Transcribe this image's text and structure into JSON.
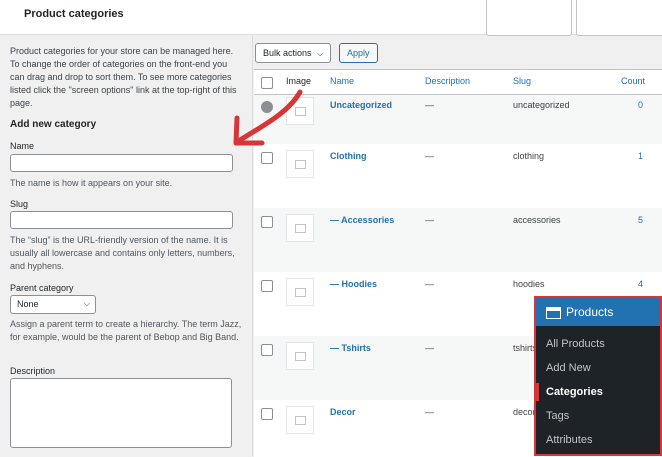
{
  "page": {
    "title": "Product categories"
  },
  "left": {
    "intro": "Product categories for your store can be managed here. To change the order of categories on the front-end you can drag and drop to sort them. To see more categories listed click the \"screen options\" link at the top-right of this page.",
    "add_heading": "Add new category",
    "name_label": "Name",
    "name_help": "The name is how it appears on your site.",
    "slug_label": "Slug",
    "slug_help": "The “slug” is the URL-friendly version of the name. It is usually all lowercase and contains only letters, numbers, and hyphens.",
    "parent_label": "Parent category",
    "parent_value": "None",
    "parent_help": "Assign a parent term to create a hierarchy. The term Jazz, for example, would be the parent of Bebop and Big Band.",
    "description_label": "Description"
  },
  "toolbar": {
    "bulk_label": "Bulk actions",
    "apply_label": "Apply"
  },
  "table": {
    "headers": {
      "image": "Image",
      "name": "Name",
      "description": "Description",
      "slug": "Slug",
      "count": "Count"
    },
    "rows": [
      {
        "name": "Uncategorized",
        "description": "—",
        "slug": "uncategorized",
        "count": "0"
      },
      {
        "name": "Clothing",
        "description": "—",
        "slug": "clothing",
        "count": "1"
      },
      {
        "name": "— Accessories",
        "description": "—",
        "slug": "accessories",
        "count": "5"
      },
      {
        "name": "— Hoodies",
        "description": "—",
        "slug": "hoodies",
        "count": "4"
      },
      {
        "name": "— Tshirts",
        "description": "—",
        "slug": "tshirts",
        "count": ""
      },
      {
        "name": "Decor",
        "description": "—",
        "slug": "decor",
        "count": ""
      }
    ]
  },
  "menu": {
    "title": "Products",
    "items": [
      "All Products",
      "Add New",
      "Categories",
      "Tags",
      "Attributes"
    ],
    "active": "Categories"
  },
  "colors": {
    "accent": "#2271b1",
    "highlight": "#d63638",
    "menu_bg": "#1d2327"
  },
  "icons": {
    "menu_icon": "product-box-icon",
    "thumbnail": "image-placeholder-icon",
    "annotation": "red-arrow-icon"
  }
}
